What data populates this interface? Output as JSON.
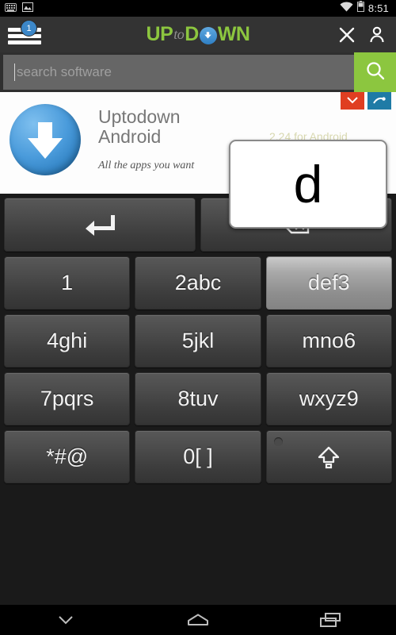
{
  "statusbar": {
    "time": "8:51",
    "icons": [
      "keyboard-icon",
      "screenshot-icon",
      "wifi-icon",
      "battery-icon"
    ]
  },
  "header": {
    "menu_badge": "1",
    "logo": {
      "part1": "UP",
      "part2": "to",
      "part3": "D",
      "part4": "WN"
    },
    "close_label": "close-icon",
    "account_label": "account-icon",
    "bg_color": "#333333",
    "accent_color": "#8cc63f"
  },
  "search": {
    "placeholder": "search software",
    "value": "",
    "button_label": "search-icon",
    "button_color": "#8cc63f"
  },
  "banner": {
    "app_name_line1": "Uptodown",
    "app_name_line2": "Android",
    "tagline": "All the apps you want",
    "version": "2.24 for Android"
  },
  "keyboard": {
    "rows": [
      [
        {
          "label": "",
          "name": "key-enter",
          "icon": "enter-arrow-icon",
          "pressed": false
        },
        {
          "label": "",
          "name": "key-backspace",
          "icon": "backspace-icon",
          "pressed": false
        }
      ],
      [
        {
          "label": "1",
          "name": "key-1",
          "pressed": false
        },
        {
          "label": "2abc",
          "name": "key-2abc",
          "pressed": false
        },
        {
          "label": "def3",
          "name": "key-def3",
          "pressed": true
        }
      ],
      [
        {
          "label": "4ghi",
          "name": "key-4ghi",
          "pressed": false
        },
        {
          "label": "5jkl",
          "name": "key-5jkl",
          "pressed": false
        },
        {
          "label": "mno6",
          "name": "key-mno6",
          "pressed": false
        }
      ],
      [
        {
          "label": "7pqrs",
          "name": "key-7pqrs",
          "pressed": false
        },
        {
          "label": "8tuv",
          "name": "key-8tuv",
          "pressed": false
        },
        {
          "label": "wxyz9",
          "name": "key-wxyz9",
          "pressed": false
        }
      ],
      [
        {
          "label": "*#@",
          "name": "key-symbols",
          "pressed": false
        },
        {
          "label": "0[ ]",
          "name": "key-0",
          "pressed": false
        },
        {
          "label": "",
          "name": "key-shift",
          "icon": "shift-icon",
          "pressed": false
        }
      ]
    ],
    "preview_char": "d"
  },
  "navbar": {
    "back_label": "hide-keyboard-chevron-icon",
    "home_label": "home-icon",
    "recents_label": "recents-icon"
  }
}
